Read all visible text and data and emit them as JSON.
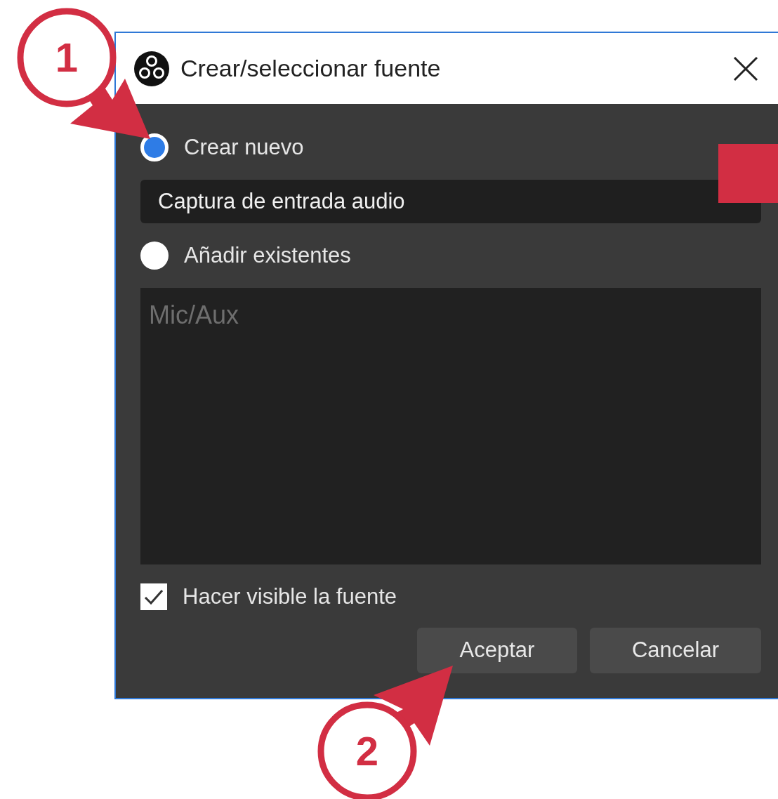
{
  "window": {
    "title": "Crear/seleccionar fuente"
  },
  "options": [
    {
      "label": "Crear nuevo",
      "selected": true
    },
    {
      "label": "Añadir existentes",
      "selected": false
    }
  ],
  "new_source_name": {
    "value": "Captura de entrada audio"
  },
  "existing_sources": [
    {
      "name": "Mic/Aux",
      "disabled": true
    }
  ],
  "visible_checkbox": {
    "label": "Hacer visible la fuente",
    "checked": true
  },
  "buttons": [
    "Aceptar",
    "Cancelar"
  ],
  "annotations": [
    {
      "label": "1"
    },
    {
      "label": "2"
    }
  ]
}
